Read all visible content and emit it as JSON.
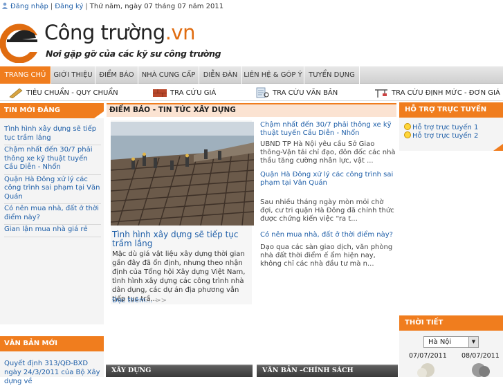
{
  "topbar": {
    "login": "Đăng nhập",
    "register": "Đăng ký",
    "date": "Thứ năm, ngày 07 tháng 07 năm 2011"
  },
  "logo": {
    "name_main": "Công trường",
    "name_ext": ".vn",
    "slogan": "Nơi gặp gỡ của các kỹ sư công trường"
  },
  "nav": {
    "items": [
      "TRANG CHỦ",
      "GIỚI THIỆU",
      "ĐIỂM BÁO",
      "NHÀ CUNG CẤP",
      "DIỄN ĐÀN",
      "LIÊN HỆ & GÓP Ý",
      "TUYỂN DỤNG"
    ],
    "active": "TRANG CHỦ"
  },
  "subnav": {
    "items": [
      "TIÊU CHUẨN - QUY CHUẨN",
      "TRA CỨU GIÁ",
      "TRA CỨU VĂN BẢN",
      "TRA CỨU ĐỊNH MỨC - ĐƠN GIÁ"
    ]
  },
  "left": {
    "title": "TIN MỚI ĐĂNG",
    "items": [
      "Tình hình xây dựng sẽ tiếp tục trầm lắng",
      "Chậm nhất đến 30/7 phải thông xe kỹ thuật tuyến Cầu Diễn - Nhổn",
      "Quận Hà Đông xử lý các công trình sai phạm tại Văn Quán",
      "Có nên mua nhà, đất ở thời điểm này?",
      "Gian lận mua nhà giá rẻ"
    ],
    "docs_title": "VĂN BẢN MỚI",
    "docs_text": "Quyết định 313/QĐ-BXD ngày 24/3/2011 của Bộ Xây dựng về"
  },
  "center": {
    "title": "ĐIỂM BÁO - TIN TỨC XÂY DỰNG",
    "feature_title": "Tình hình xây dựng sẽ tiếp tục trầm lắng",
    "feature_desc": "Mặc dù giá vật liệu xây dựng thời gian gần đây đã ổn định, nhưng theo nhận định của Tổng hội Xây dựng Việt Nam, tình hình xây dựng các công trình nhà dân dụng, các dự án địa phương vẫn tiếp tục trầ...",
    "readmore": "Đọc thêm...",
    "readmore_arrows": ">>",
    "news": [
      {
        "title": "Chậm nhất đến 30/7 phải thông xe kỹ thuật tuyến Cầu Diễn - Nhổn",
        "desc": "UBND TP Hà Nội yêu cầu Sở Giao thông-Vận tải chỉ đạo, đôn đốc các nhà thầu tăng cường nhân lực, vật ..."
      },
      {
        "title": "Quận Hà Đông xử lý các công trình sai phạm tại Văn Quán",
        "desc": "Sau nhiều tháng ngày mòn mỏi chờ đợi, cư tri quận Hà Đông đã chính thức được chứng kiến việc “ra t..."
      },
      {
        "title": "Có nên mua nhà, đất ở thời điểm này?",
        "desc": "Dạo qua các sàn giao dịch, văn phòng nhà đất thời điểm ế ẩm hiện nay, không chỉ các nhà đầu tư mà n..."
      }
    ],
    "bottom_heads": [
      "XÂY DỰNG",
      "VĂN BẢN –CHÍNH SÁCH"
    ]
  },
  "right": {
    "support_title": "HỖ TRỢ TRỰC TUYẾN",
    "support_items": [
      "Hỗ trợ trực tuyến 1",
      "Hỗ trợ trực tuyến 2"
    ],
    "weather_title": "THỜI TIẾT",
    "weather_city": "Hà Nội",
    "weather_dates": [
      "07/07/2011",
      "08/07/2011"
    ]
  },
  "colors": {
    "accent": "#f07d1e",
    "link": "#1f5fa8"
  }
}
